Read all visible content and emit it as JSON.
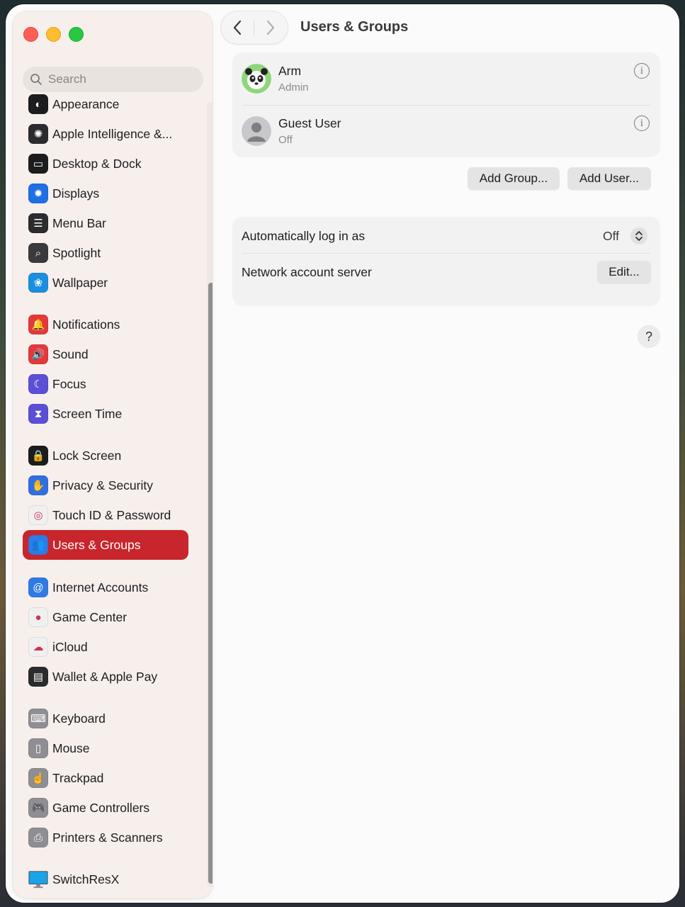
{
  "window": {
    "title": "Users & Groups"
  },
  "sidebar": {
    "search_placeholder": "Search",
    "items": [
      {
        "label": "Appearance",
        "icon": "appearance-icon",
        "color": "#1c1c1e",
        "glyph": "◐"
      },
      {
        "label": "Apple Intelligence &...",
        "icon": "apple-intelligence-icon",
        "color": "#2b2b2e",
        "glyph": "✺"
      },
      {
        "label": "Desktop & Dock",
        "icon": "desktop-dock-icon",
        "color": "#1c1c1e",
        "glyph": "▭"
      },
      {
        "label": "Displays",
        "icon": "displays-icon",
        "color": "#1f6fe5",
        "glyph": "✹"
      },
      {
        "label": "Menu Bar",
        "icon": "menu-bar-icon",
        "color": "#2c2c2e",
        "glyph": "☰"
      },
      {
        "label": "Spotlight",
        "icon": "spotlight-icon",
        "color": "#3a3a3c",
        "glyph": "⌕"
      },
      {
        "label": "Wallpaper",
        "icon": "wallpaper-icon",
        "color": "#1a8fe0",
        "glyph": "❀"
      },
      {
        "label": "Notifications",
        "icon": "notifications-icon",
        "color": "#e5383b",
        "glyph": "🔔"
      },
      {
        "label": "Sound",
        "icon": "sound-icon",
        "color": "#e5383b",
        "glyph": "🔊"
      },
      {
        "label": "Focus",
        "icon": "focus-icon",
        "color": "#5b4fd6",
        "glyph": "☾"
      },
      {
        "label": "Screen Time",
        "icon": "screen-time-icon",
        "color": "#5b4fd6",
        "glyph": "⧗"
      },
      {
        "label": "Lock Screen",
        "icon": "lock-screen-icon",
        "color": "#1c1c1e",
        "glyph": "🔒"
      },
      {
        "label": "Privacy & Security",
        "icon": "privacy-hand-icon",
        "color": "#2f6fe0",
        "glyph": "✋"
      },
      {
        "label": "Touch ID & Password",
        "icon": "fingerprint-icon",
        "color": "#f0f0f0",
        "glyph": "◎"
      },
      {
        "label": "Users & Groups",
        "icon": "users-groups-icon",
        "color": "#2f7be5",
        "glyph": "👥"
      },
      {
        "label": "Internet Accounts",
        "icon": "internet-accounts-icon",
        "color": "#2f7be5",
        "glyph": "@"
      },
      {
        "label": "Game Center",
        "icon": "game-center-icon",
        "color": "#f0f0f0",
        "glyph": "●"
      },
      {
        "label": "iCloud",
        "icon": "icloud-icon",
        "color": "#f0f0f0",
        "glyph": "☁"
      },
      {
        "label": "Wallet & Apple Pay",
        "icon": "wallet-icon",
        "color": "#2c2c2e",
        "glyph": "▤"
      },
      {
        "label": "Keyboard",
        "icon": "keyboard-icon",
        "color": "#8e8e93",
        "glyph": "⌨"
      },
      {
        "label": "Mouse",
        "icon": "mouse-icon",
        "color": "#8e8e93",
        "glyph": "▯"
      },
      {
        "label": "Trackpad",
        "icon": "trackpad-icon",
        "color": "#8e8e93",
        "glyph": "☝"
      },
      {
        "label": "Game Controllers",
        "icon": "game-controller-icon",
        "color": "#8e8e93",
        "glyph": "🎮"
      },
      {
        "label": "Printers & Scanners",
        "icon": "printer-icon",
        "color": "#8e8e93",
        "glyph": "⎙"
      },
      {
        "label": "SwitchResX",
        "icon": "switchresx-icon",
        "color": "#1aa3e8",
        "glyph": ""
      }
    ]
  },
  "users": [
    {
      "name": "Arm",
      "role": "Admin"
    },
    {
      "name": "Guest User",
      "role": "Off"
    }
  ],
  "buttons": {
    "add_group": "Add Group...",
    "add_user": "Add User...",
    "edit": "Edit...",
    "help": "?"
  },
  "settings": {
    "auto_login_label": "Automatically log in as",
    "auto_login_value": "Off",
    "network_server_label": "Network account server"
  },
  "colors": {
    "selected": "#c9252c",
    "close": "#ff5f57",
    "minimize": "#febc2e",
    "maximize": "#28c840"
  }
}
